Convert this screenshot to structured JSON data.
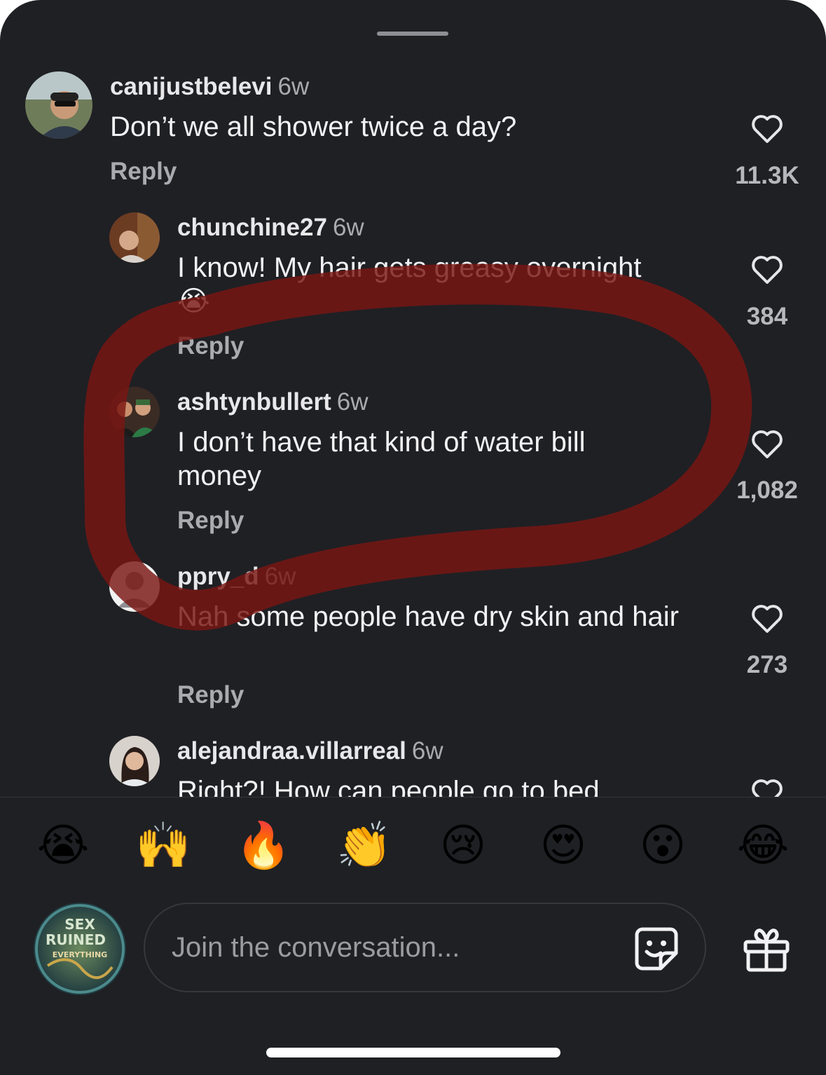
{
  "comments": [
    {
      "username": "canijustbelevi",
      "time": "6w",
      "text": "Don’t we all shower twice a day?",
      "reply": "Reply",
      "likes": "11.3K"
    },
    {
      "username": "chunchine27",
      "time": "6w",
      "text": "I know! My hair gets greasy overnight",
      "emoji": "😭",
      "reply": "Reply",
      "likes": "384"
    },
    {
      "username": "ashtynbullert",
      "time": "6w",
      "text": "I don’t have that kind of water bill money",
      "reply": "Reply",
      "likes": "1,082"
    },
    {
      "username": "ppry_d",
      "time": "6w",
      "text": "Nah some people have dry skin and hair",
      "reply": "Reply",
      "likes": "273"
    },
    {
      "username": "alejandraa.villarreal",
      "time": "6w",
      "text": "Right?! How can people go to bed"
    }
  ],
  "quick_emojis": [
    "😭",
    "🙌",
    "🔥",
    "👏",
    "😢",
    "😍",
    "😮",
    "😂"
  ],
  "composer": {
    "placeholder": "Join the conversation...",
    "avatar_text": "SEX RUINED EVERYTHING"
  },
  "colors": {
    "sheet": "#1f2024",
    "scribble": "#7a1612",
    "muted": "#a9abb0"
  }
}
